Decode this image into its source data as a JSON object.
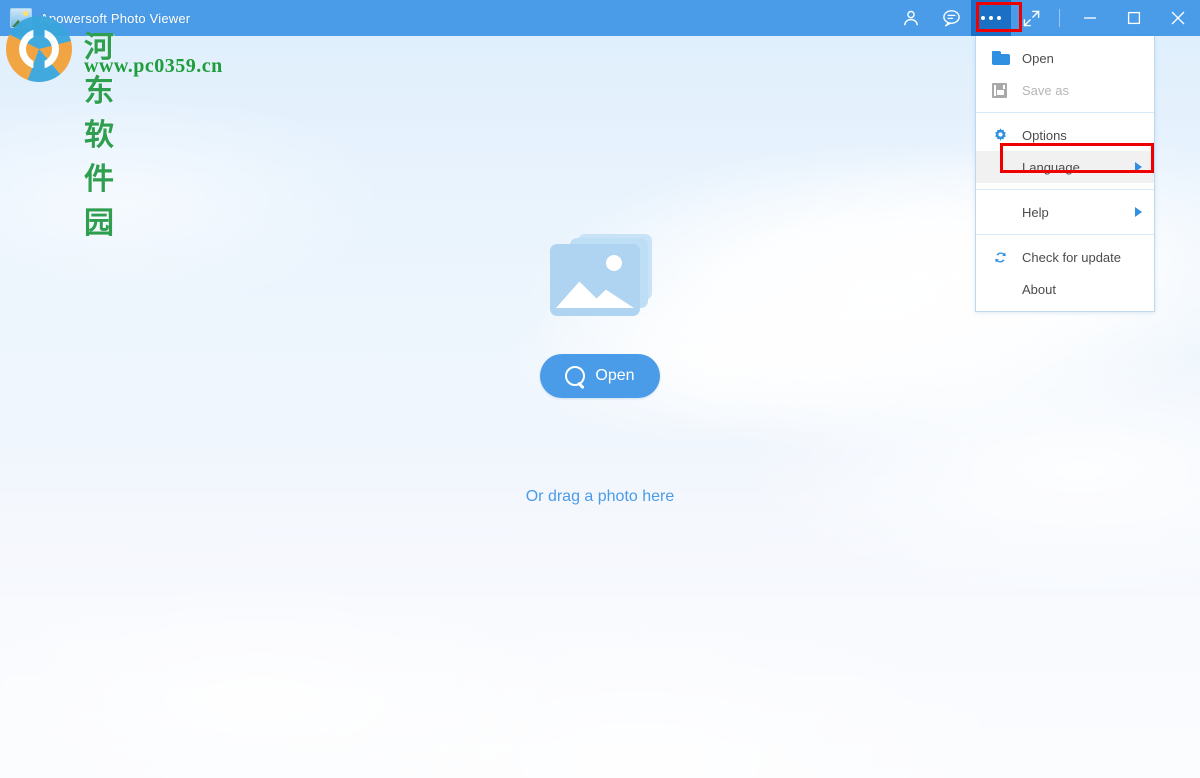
{
  "window": {
    "title": "Apowersoft Photo Viewer",
    "app_icon": "photo-app-icon",
    "titlebar_color": "#4a9ce8",
    "active_button_color": "#1b6fc4"
  },
  "titlebar_buttons": [
    {
      "name": "account-icon",
      "label": "",
      "icon": "person-icon",
      "active": false
    },
    {
      "name": "feedback-icon",
      "label": "",
      "icon": "chat-bubble-icon",
      "active": false
    },
    {
      "name": "more-menu-button",
      "label": "",
      "icon": "three-dots-icon",
      "active": true
    },
    {
      "name": "fullscreen-icon",
      "label": "",
      "icon": "expand-arrows-icon",
      "active": false
    }
  ],
  "window_controls": [
    {
      "name": "minimize-button",
      "glyph": "minimize-icon"
    },
    {
      "name": "maximize-button",
      "glyph": "maximize-icon"
    },
    {
      "name": "close-button",
      "glyph": "close-icon"
    }
  ],
  "menu": {
    "groups": [
      {
        "items": [
          {
            "label": "Open",
            "icon": "folder-icon",
            "disabled": false,
            "submenu": false,
            "hovered": false
          },
          {
            "label": "Save as",
            "icon": "floppy-disk-icon",
            "disabled": true,
            "submenu": false,
            "hovered": false
          }
        ]
      },
      {
        "items": [
          {
            "label": "Options",
            "icon": "gear-icon",
            "disabled": false,
            "submenu": false,
            "hovered": false
          },
          {
            "label": "Language",
            "icon": "",
            "disabled": false,
            "submenu": true,
            "hovered": true
          }
        ]
      },
      {
        "items": [
          {
            "label": "Help",
            "icon": "",
            "disabled": false,
            "submenu": true,
            "hovered": false
          }
        ]
      },
      {
        "items": [
          {
            "label": "Check for update",
            "icon": "refresh-icon",
            "disabled": false,
            "submenu": false,
            "hovered": false
          },
          {
            "label": "About",
            "icon": "",
            "disabled": false,
            "submenu": false,
            "hovered": false
          }
        ]
      }
    ]
  },
  "main": {
    "placeholder_icon": "stacked-photos-icon",
    "open_button_label": "Open",
    "open_button_icon": "magnifier-icon",
    "drag_hint": "Or drag a photo here",
    "accent_color": "#4a9ce8"
  },
  "highlights": {
    "menu_button_box": "more-menu-button",
    "language_box": "menu-item-language",
    "color": "#ee0000"
  },
  "watermark": {
    "site_name": "河东软件园",
    "url": "www.pc0359.cn",
    "logo": "hedong-logo"
  }
}
